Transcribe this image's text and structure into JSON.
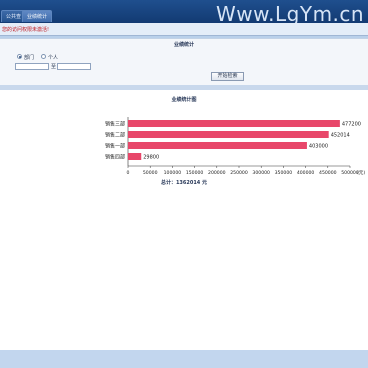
{
  "tabs": [
    {
      "label": "公共查",
      "active": false
    },
    {
      "label": "业绩统计",
      "active": true
    }
  ],
  "watermark": "Www.LgYm.cn",
  "notice": "您的访问权限未激活!",
  "search": {
    "title": "业绩统计",
    "radio_dept": "部门",
    "radio_person": "个人",
    "selected": "部门",
    "date_from": "",
    "date_to": "",
    "date_sep": "至",
    "button_label": "开始检索"
  },
  "chart": {
    "title": "业绩统计图",
    "total_label": "总计：1362014 元"
  },
  "chart_data": {
    "type": "bar",
    "orientation": "horizontal",
    "categories": [
      "销售三部",
      "销售二部",
      "销售一部",
      "销售四部"
    ],
    "values": [
      477200,
      452014,
      403000,
      29800
    ],
    "xlim": [
      0,
      500000
    ],
    "xticks": [
      0,
      50000,
      100000,
      150000,
      200000,
      250000,
      300000,
      350000,
      400000,
      450000,
      500000
    ],
    "unit_label": "(元)",
    "bar_color": "#e8476a",
    "grid": false
  }
}
